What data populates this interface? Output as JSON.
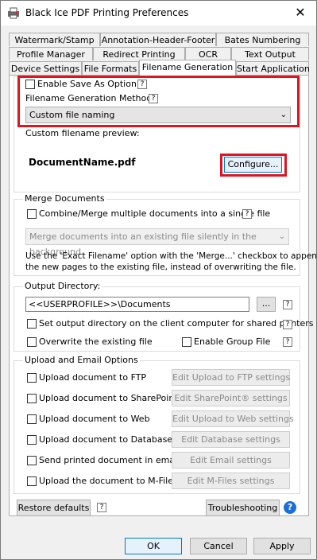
{
  "window": {
    "title": "Black Ice PDF Printing Preferences",
    "close_glyph": "✕"
  },
  "tabs": {
    "row1": [
      "Watermark/Stamp",
      "Annotation-Header-Footer",
      "Bates Numbering"
    ],
    "row2": [
      "Profile Manager",
      "Redirect Printing",
      "OCR",
      "Text Output"
    ],
    "row3": [
      "Device Settings",
      "File Formats",
      "Filename Generation",
      "Start Application"
    ]
  },
  "filename": {
    "enable_save_as": "Enable Save As Option",
    "methods_label": "Filename Generation Methods",
    "method_selected": "Custom file naming",
    "preview_label": "Custom filename preview:",
    "preview_value": "DocumentName.pdf",
    "configure_label": "Configure..."
  },
  "merge": {
    "group_label": "Merge Documents",
    "combine_label": "Combine/Merge multiple documents into a single file",
    "mode_selected": "Merge documents into an existing file silently in the background.",
    "note_line1": "Use the 'Exact Filename' option with the 'Merge...' checkbox to append",
    "note_line2": "the new pages to the existing file, instead of overwriting the file."
  },
  "output": {
    "group_label": "Output Directory:",
    "path_value": "<<USERPROFILE>>\\Documents",
    "browse_label": "...",
    "client_dir_label": "Set output directory on the client computer for shared printers",
    "overwrite_label": "Overwrite the existing file",
    "group_file_label": "Enable Group File"
  },
  "upload": {
    "group_label": "Upload and Email Options",
    "items": [
      {
        "label": "Upload document to FTP",
        "button": "Edit Upload to FTP settings"
      },
      {
        "label": "Upload document to SharePoint®",
        "button": "Edit SharePoint® settings"
      },
      {
        "label": "Upload document to Web",
        "button": "Edit Upload to Web settings"
      },
      {
        "label": "Upload document to Database",
        "button": "Edit Database settings"
      },
      {
        "label": "Send printed document in email",
        "button": "Edit Email settings"
      },
      {
        "label": "Upload the document to M-Files",
        "button": "Edit M-Files settings"
      }
    ]
  },
  "footer": {
    "restore_label": "Restore defaults",
    "troubleshooting_label": "Troubleshooting",
    "help_glyph": "?",
    "ok_label": "OK",
    "cancel_label": "Cancel",
    "apply_label": "Apply"
  },
  "help_glyph": "?",
  "colors": {
    "highlight_red": "#e0141e",
    "focus_blue": "#0078d7",
    "help_blue": "#1a6fd8"
  }
}
